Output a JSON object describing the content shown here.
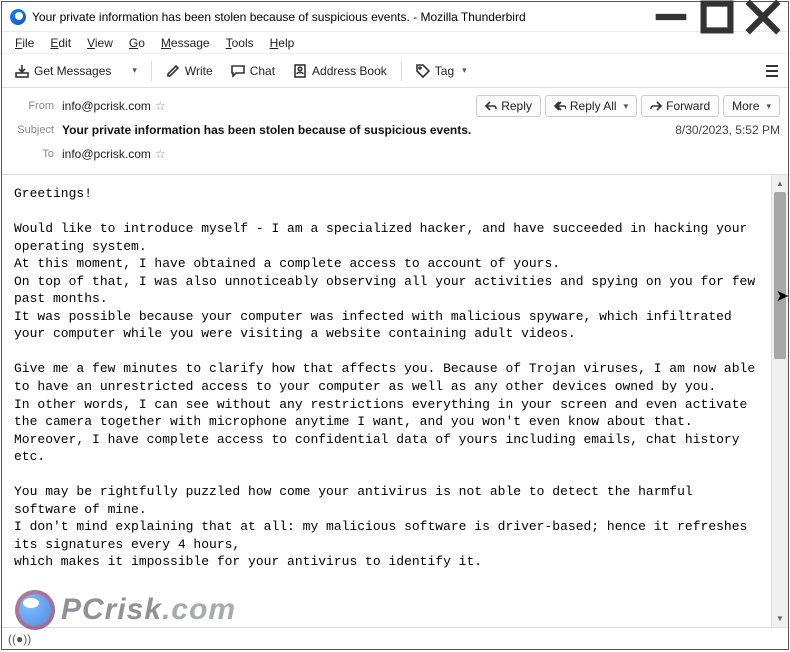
{
  "titlebar": {
    "title": "Your private information has been stolen because of suspicious events. - Mozilla Thunderbird"
  },
  "menubar": {
    "file": "File",
    "edit": "Edit",
    "view": "View",
    "go": "Go",
    "message": "Message",
    "tools": "Tools",
    "help": "Help"
  },
  "toolbar": {
    "get_messages": "Get Messages",
    "write": "Write",
    "chat": "Chat",
    "address_book": "Address Book",
    "tag": "Tag"
  },
  "headers": {
    "from_label": "From",
    "from_value": "info@pcrisk.com",
    "subject_label": "Subject",
    "subject_value": "Your private information has been stolen because of suspicious events.",
    "to_label": "To",
    "to_value": "info@pcrisk.com",
    "date": "8/30/2023, 5:52 PM",
    "actions": {
      "reply": "Reply",
      "reply_all": "Reply All",
      "forward": "Forward",
      "more": "More"
    }
  },
  "body": "Greetings!\n\nWould like to introduce myself - I am a specialized hacker, and have succeeded in hacking your operating system.\nAt this moment, I have obtained a complete access to account of yours.\nOn top of that, I was also unnoticeably observing all your activities and spying on you for few past months.\nIt was possible because your computer was infected with malicious spyware, which infiltrated your computer while you were visiting a website containing adult videos.\n\nGive me a few minutes to clarify how that affects you. Because of Trojan viruses, I am now able to have an unrestricted access to your computer as well as any other devices owned by you.\nIn other words, I can see without any restrictions everything in your screen and even activate the camera together with microphone anytime I want, and you won't even know about that.\nMoreover, I have complete access to confidential data of yours including emails, chat history etc.\n\nYou may be rightfully puzzled how come your antivirus is not able to detect the harmful software of mine.\nI don't mind explaining that at all: my malicious software is driver-based; hence it refreshes its signatures every 4 hours,\nwhich makes it impossible for your antivirus to identify it.",
  "watermark": {
    "text": "PCrisk",
    "domain": ".com"
  }
}
